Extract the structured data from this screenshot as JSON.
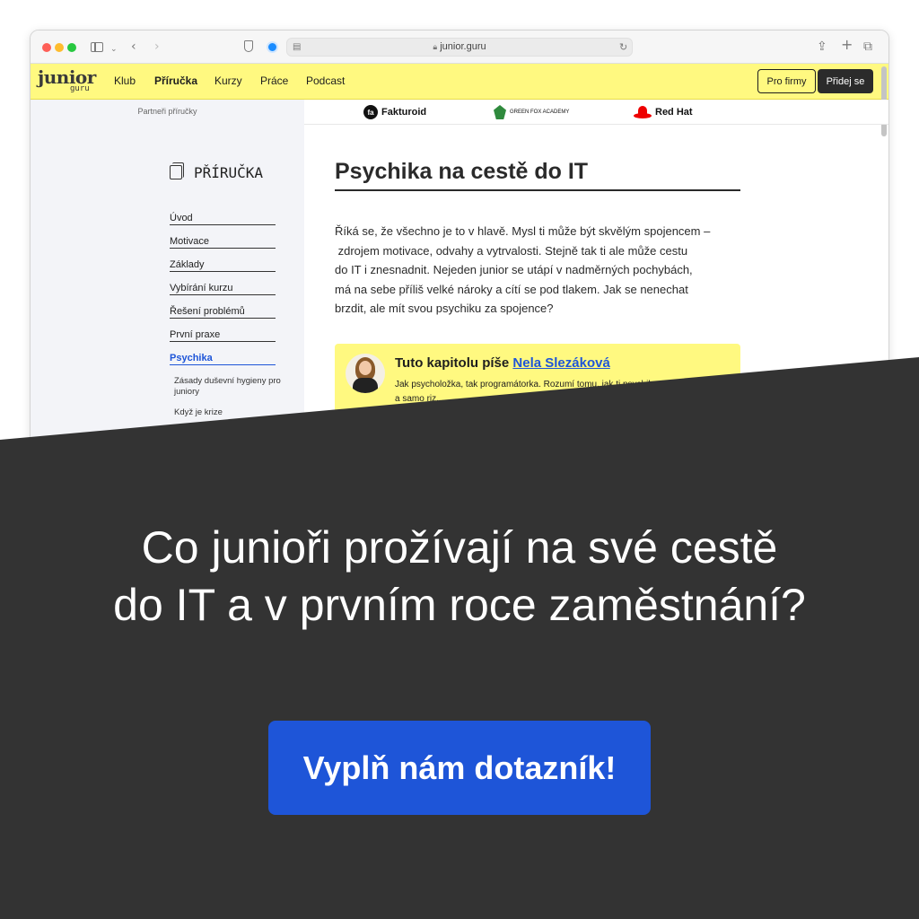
{
  "browser": {
    "url": "junior.guru"
  },
  "site": {
    "logo_main": "junior",
    "logo_sub": "guru",
    "nav": [
      "Klub",
      "Příručka",
      "Kurzy",
      "Práce",
      "Podcast"
    ],
    "active_nav": "Příručka",
    "btn_companies": "Pro firmy",
    "btn_join": "Přidej se"
  },
  "partners": {
    "label": "Partneři příručky",
    "items": [
      "Fakturoid",
      "GREEN FOX ACADEMY",
      "Red Hat"
    ]
  },
  "sidebar": {
    "title": "PŘÍRUČKA",
    "items": [
      "Úvod",
      "Motivace",
      "Základy",
      "Vybírání kurzu",
      "Řešení problémů",
      "První praxe",
      "Psychika"
    ],
    "active_item": "Psychika",
    "subitems": [
      "Zásady duševní hygieny pro juniory",
      "Když je krize"
    ]
  },
  "article": {
    "title": "Psychika na cestě do IT",
    "lead_lines": [
      "Říká se, že všechno je to v hlavě. Mysl ti může být skvělým spojencem –",
      " zdrojem motivace, odvahy a vytrvalosti. Stejně tak ti ale může cestu",
      "do IT i znesnadnit. Nejeden junior se utápí v nadměrných pochybách,",
      "má na sebe příliš velké nároky a cítí se pod tlakem. Jak se nenechat",
      "brzdit, ale mít svou psychiku za spojence?"
    ],
    "author_prefix": "Tuto kapitolu píše ",
    "author_name": "Nela Slezáková",
    "author_desc": "Jak psycholožka, tak programátorka. Rozumí tomu, jak ti psychika a samo riz..."
  },
  "promo": {
    "headline_line1": "Co junioři prožívají na své cestě",
    "headline_line2": "do IT a v prvním roce zaměstnání?",
    "cta": "Vyplň nám dotazník!"
  },
  "colors": {
    "site_yellow": "#fff980",
    "dark_panel": "#333333",
    "cta_blue": "#1e55d8",
    "link_blue": "#1e55d8"
  }
}
